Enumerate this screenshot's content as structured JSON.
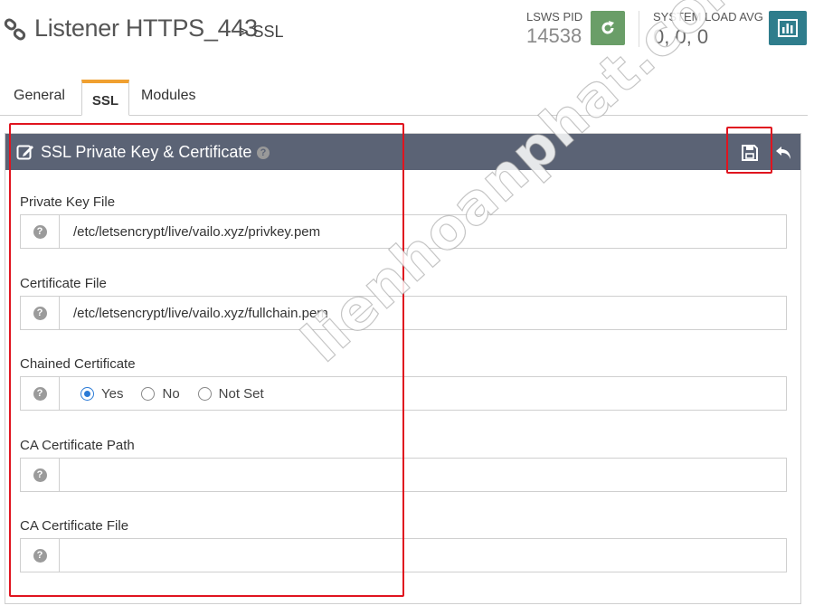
{
  "header": {
    "title": "Listener HTTPS_443",
    "breadcrumb": "> SSL",
    "pid_label": "LSWS PID",
    "pid_value": "14538",
    "load_label": "SYSTEM LOAD AVG",
    "load_value": "0, 0, 0"
  },
  "tabs": [
    {
      "label": "General",
      "active": false
    },
    {
      "label": "SSL",
      "active": true
    },
    {
      "label": "Modules",
      "active": false
    }
  ],
  "panel": {
    "title": "SSL Private Key & Certificate",
    "fields": [
      {
        "label": "Private Key File",
        "value": "/etc/letsencrypt/live/vailo.xyz/privkey.pem"
      },
      {
        "label": "Certificate File",
        "value": "/etc/letsencrypt/live/vailo.xyz/fullchain.pem"
      },
      {
        "label": "Chained Certificate",
        "options": [
          "Yes",
          "No",
          "Not Set"
        ],
        "selected": "Yes"
      },
      {
        "label": "CA Certificate Path",
        "value": ""
      },
      {
        "label": "CA Certificate File",
        "value": ""
      }
    ]
  },
  "watermark": "lienhoanphat.com",
  "colors": {
    "restart_button": "#6a9e68",
    "chart_button": "#2f7d8c",
    "panel_header": "#5b6375",
    "active_tab_accent": "#f0a030",
    "highlight": "#e0141f"
  },
  "icons": {
    "title": "link-icon",
    "restart": "refresh-icon",
    "load": "bar-chart-icon",
    "panel": "edit-icon",
    "save": "floppy-disk-icon",
    "undo": "undo-arrow-icon",
    "help": "question-circle-icon"
  }
}
